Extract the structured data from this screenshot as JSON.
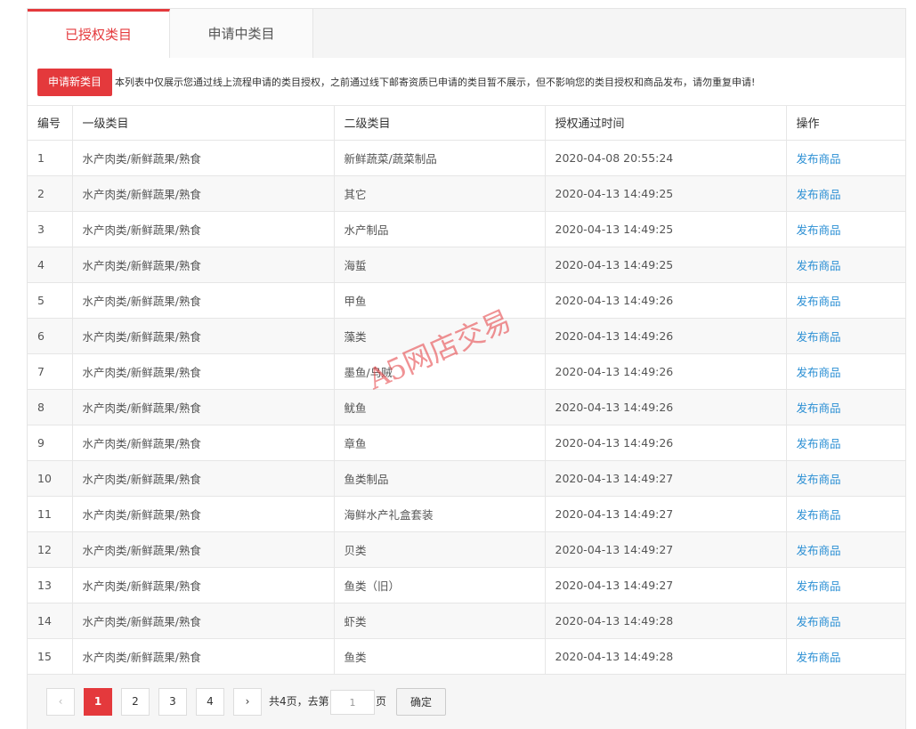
{
  "tabs": [
    {
      "label": "已授权类目",
      "active": true
    },
    {
      "label": "申请中类目",
      "active": false
    }
  ],
  "toolbar": {
    "apply_label": "申请新类目",
    "notice": "本列表中仅展示您通过线上流程申请的类目授权，之前通过线下邮寄资质已申请的类目暂不展示，但不影响您的类目授权和商品发布，请勿重复申请!"
  },
  "table": {
    "headers": [
      "编号",
      "一级类目",
      "二级类目",
      "授权通过时间",
      "操作"
    ],
    "rows": [
      {
        "no": "1",
        "level1": "水产肉类/新鲜蔬果/熟食",
        "level2": "新鲜蔬菜/蔬菜制品",
        "time": "2020-04-08 20:55:24",
        "action": "发布商品"
      },
      {
        "no": "2",
        "level1": "水产肉类/新鲜蔬果/熟食",
        "level2": "其它",
        "time": "2020-04-13 14:49:25",
        "action": "发布商品"
      },
      {
        "no": "3",
        "level1": "水产肉类/新鲜蔬果/熟食",
        "level2": "水产制品",
        "time": "2020-04-13 14:49:25",
        "action": "发布商品"
      },
      {
        "no": "4",
        "level1": "水产肉类/新鲜蔬果/熟食",
        "level2": "海蜇",
        "time": "2020-04-13 14:49:25",
        "action": "发布商品"
      },
      {
        "no": "5",
        "level1": "水产肉类/新鲜蔬果/熟食",
        "level2": "甲鱼",
        "time": "2020-04-13 14:49:26",
        "action": "发布商品"
      },
      {
        "no": "6",
        "level1": "水产肉类/新鲜蔬果/熟食",
        "level2": "藻类",
        "time": "2020-04-13 14:49:26",
        "action": "发布商品"
      },
      {
        "no": "7",
        "level1": "水产肉类/新鲜蔬果/熟食",
        "level2": "墨鱼/乌贼",
        "time": "2020-04-13 14:49:26",
        "action": "发布商品"
      },
      {
        "no": "8",
        "level1": "水产肉类/新鲜蔬果/熟食",
        "level2": "鱿鱼",
        "time": "2020-04-13 14:49:26",
        "action": "发布商品"
      },
      {
        "no": "9",
        "level1": "水产肉类/新鲜蔬果/熟食",
        "level2": "章鱼",
        "time": "2020-04-13 14:49:26",
        "action": "发布商品"
      },
      {
        "no": "10",
        "level1": "水产肉类/新鲜蔬果/熟食",
        "level2": "鱼类制品",
        "time": "2020-04-13 14:49:27",
        "action": "发布商品"
      },
      {
        "no": "11",
        "level1": "水产肉类/新鲜蔬果/熟食",
        "level2": "海鲜水产礼盒套装",
        "time": "2020-04-13 14:49:27",
        "action": "发布商品"
      },
      {
        "no": "12",
        "level1": "水产肉类/新鲜蔬果/熟食",
        "level2": "贝类",
        "time": "2020-04-13 14:49:27",
        "action": "发布商品"
      },
      {
        "no": "13",
        "level1": "水产肉类/新鲜蔬果/熟食",
        "level2": "鱼类（旧）",
        "time": "2020-04-13 14:49:27",
        "action": "发布商品"
      },
      {
        "no": "14",
        "level1": "水产肉类/新鲜蔬果/熟食",
        "level2": "虾类",
        "time": "2020-04-13 14:49:28",
        "action": "发布商品"
      },
      {
        "no": "15",
        "level1": "水产肉类/新鲜蔬果/熟食",
        "level2": "鱼类",
        "time": "2020-04-13 14:49:28",
        "action": "发布商品"
      }
    ]
  },
  "pagination": {
    "prev": "‹",
    "next": "›",
    "pages": [
      "1",
      "2",
      "3",
      "4"
    ],
    "current": "1",
    "total_text": "共4页，去第",
    "input_value": "1",
    "page_suffix": "页",
    "confirm_label": "确定"
  },
  "watermark": "A5网店交易",
  "colors": {
    "accent": "#e4393c",
    "link": "#2b8fd4"
  }
}
